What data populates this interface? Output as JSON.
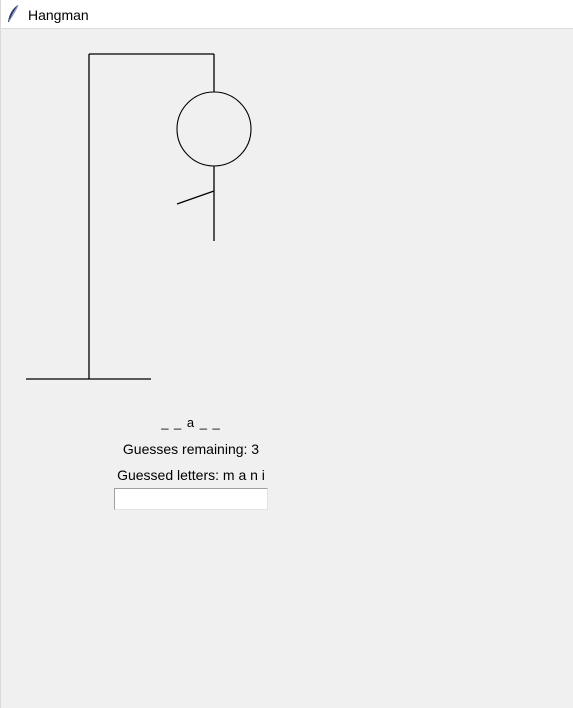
{
  "window": {
    "title": "Hangman",
    "icon": "feather-icon"
  },
  "game": {
    "word_display": "_ _ a _ _",
    "remaining_text": "Guesses remaining: 3",
    "guessed_text": "Guessed letters: m a n i",
    "guess_input_value": ""
  },
  "drawing": {
    "parts_drawn": [
      "base",
      "pole",
      "beam",
      "rope",
      "head",
      "body",
      "left-arm"
    ]
  }
}
